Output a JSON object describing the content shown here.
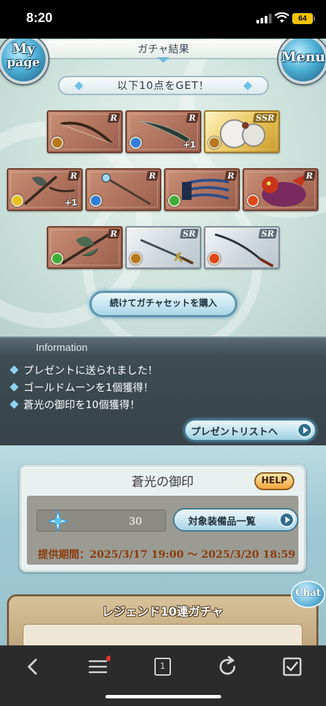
{
  "status_bar": {
    "time": "8:20",
    "battery": "64"
  },
  "header": {
    "title": "ガチャ結果",
    "mypage_line1": "My",
    "mypage_line2": "page",
    "menu_label": "Menu"
  },
  "banner": {
    "text": "以下10点をGET！"
  },
  "items": [
    {
      "rarity": "R",
      "element": "earth",
      "weapon": "bow",
      "plus": ""
    },
    {
      "rarity": "R",
      "element": "water",
      "weapon": "dagger",
      "plus": "+1"
    },
    {
      "rarity": "SSR",
      "element": "earth",
      "weapon": "summon-orb",
      "plus": ""
    },
    {
      "rarity": "R",
      "element": "light",
      "weapon": "axe",
      "plus": "+1"
    },
    {
      "rarity": "R",
      "element": "water",
      "weapon": "staff",
      "plus": ""
    },
    {
      "rarity": "R",
      "element": "wind",
      "weapon": "claw",
      "plus": ""
    },
    {
      "rarity": "R",
      "element": "fire",
      "weapon": "summon-beast",
      "plus": ""
    },
    {
      "rarity": "R",
      "element": "wind",
      "weapon": "great-axe",
      "plus": ""
    },
    {
      "rarity": "SR",
      "element": "earth",
      "weapon": "sword",
      "plus": ""
    },
    {
      "rarity": "SR",
      "element": "fire",
      "weapon": "katana",
      "plus": ""
    }
  ],
  "element_colors": {
    "earth": "#b8781e",
    "water": "#2f7fd8",
    "light": "#e8c21c",
    "wind": "#3fae3a",
    "fire": "#e0461c"
  },
  "buy_button": {
    "label": "続けてガチャセットを購入"
  },
  "information": {
    "heading": "Information",
    "lines": [
      "プレゼントに送られました！",
      "ゴールドムーンを1個獲得！",
      "蒼光の御印を10個獲得！"
    ],
    "present_button": "プレゼントリストへ"
  },
  "seal": {
    "title": "蒼光の御印",
    "help": "HELP",
    "count": "30",
    "equip_button": "対象装備品一覧",
    "period": "提供期間：2025/3/17 19:00 〜 2025/3/20 18:59"
  },
  "legend": {
    "title": "レジェンド10連ガチャ",
    "chat": "Chat"
  },
  "browser_toolbar": {
    "tabs_count": "1"
  }
}
